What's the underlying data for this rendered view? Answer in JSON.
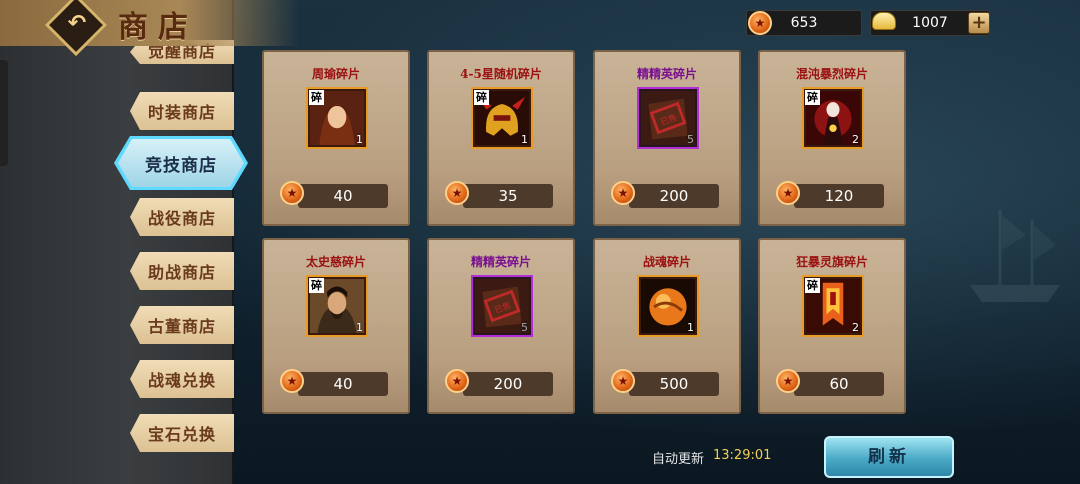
{
  "header": {
    "title": "商店"
  },
  "currency": {
    "coins": "653",
    "ingots": "1007"
  },
  "sidebar": {
    "tabs": [
      "觉醒商店",
      "时装商店",
      "竞技商店",
      "战役商店",
      "助战商店",
      "古董商店",
      "战魂兑换",
      "宝石兑换"
    ],
    "active_index": 2
  },
  "items": [
    {
      "name": "周瑜碎片",
      "name_color": "#9b1010",
      "count": "1",
      "price": "40",
      "frame": "orange",
      "art": "hero",
      "fragment_badge": "碎"
    },
    {
      "name": "4-5星随机碎片",
      "name_color": "#9b1010",
      "count": "1",
      "price": "35",
      "frame": "orange",
      "art": "helmet",
      "fragment_badge": "碎"
    },
    {
      "name": "精精英碎片",
      "name_color": "#7a1090",
      "count": "5",
      "price": "200",
      "frame": "purple",
      "art": "scroll",
      "fragment_badge": ""
    },
    {
      "name": "混沌暴烈碎片",
      "name_color": "#9b1010",
      "count": "2",
      "price": "120",
      "frame": "orange",
      "art": "demon",
      "fragment_badge": "碎"
    },
    {
      "name": "太史慈碎片",
      "name_color": "#9b1010",
      "count": "1",
      "price": "40",
      "frame": "orange",
      "art": "hero2",
      "fragment_badge": "碎"
    },
    {
      "name": "精精英碎片",
      "name_color": "#7a1090",
      "count": "5",
      "price": "200",
      "frame": "purple",
      "art": "scroll",
      "fragment_badge": ""
    },
    {
      "name": "战魂碎片",
      "name_color": "#9b1010",
      "count": "1",
      "price": "500",
      "frame": "orange",
      "art": "orb",
      "fragment_badge": ""
    },
    {
      "name": "狂暴灵旗碎片",
      "name_color": "#9b1010",
      "count": "2",
      "price": "60",
      "frame": "orange",
      "art": "banner",
      "fragment_badge": "碎"
    }
  ],
  "footer": {
    "refresh_label": "自动更新",
    "refresh_time": "13:29:01",
    "refresh_button": "刷新"
  }
}
